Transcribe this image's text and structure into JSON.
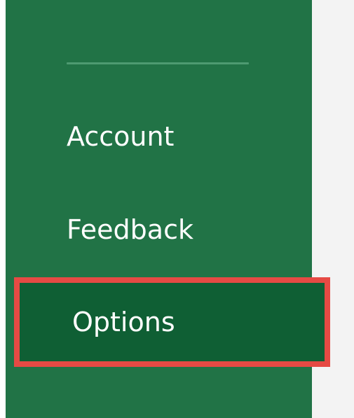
{
  "sidebar": {
    "items": [
      {
        "label": "Account"
      },
      {
        "label": "Feedback"
      },
      {
        "label": "Options",
        "selected": true,
        "highlighted": true
      }
    ]
  },
  "colors": {
    "sidebar_background": "#217346",
    "selected_background": "#0f5f34",
    "highlight_border": "#e64a44",
    "content_background": "#f3f3f3",
    "separator": "#4e9a71",
    "text": "#ffffff"
  }
}
